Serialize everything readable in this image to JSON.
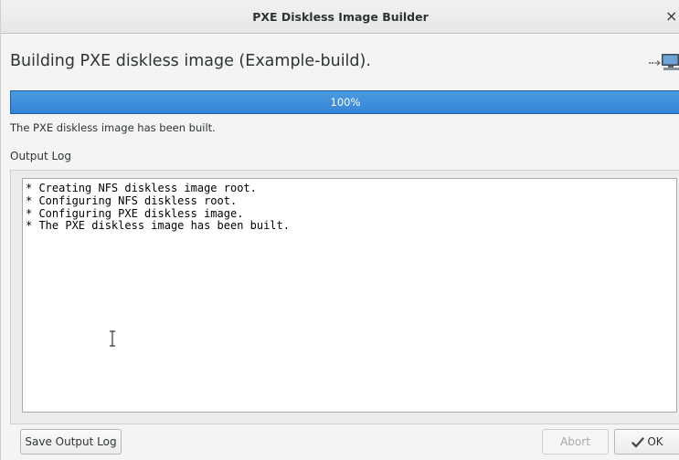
{
  "window": {
    "title": "PXE Diskless Image Builder",
    "close_label": "×"
  },
  "header": {
    "heading": "Building PXE diskless image (Example-build)."
  },
  "progress": {
    "label": "100%",
    "value": 1.0
  },
  "status_text": "The PXE diskless image has been built.",
  "output_log": {
    "label": "Output Log",
    "lines": [
      "* Creating NFS diskless image root.",
      "* Configuring NFS diskless root.",
      "* Configuring PXE diskless image.",
      "* The PXE diskless image has been built."
    ]
  },
  "buttons": {
    "save_log": "Save Output Log",
    "abort": "Abort",
    "ok": "OK"
  },
  "icons": {
    "header": "network-computer-icon",
    "ok": "ok-check-icon"
  },
  "colors": {
    "progress_fill": "#3584d8",
    "progress_border": "#2160a8"
  }
}
